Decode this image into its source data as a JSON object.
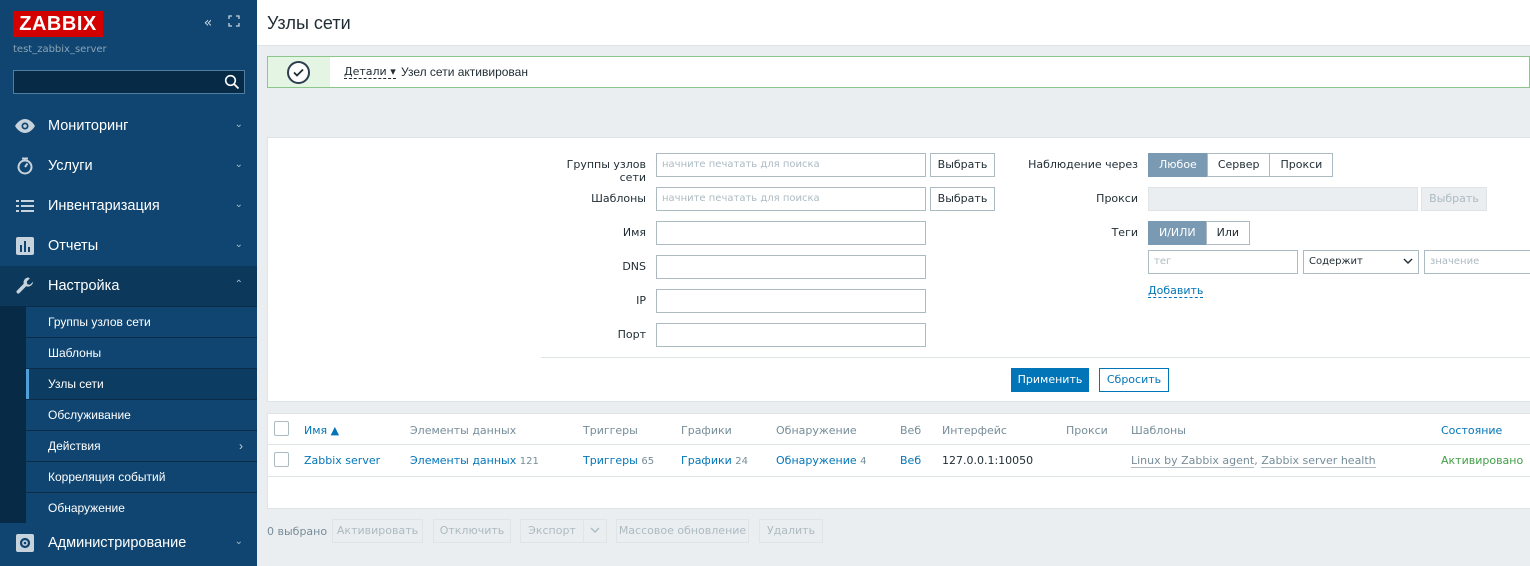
{
  "sidebar": {
    "logo": "ZABBIX",
    "server_name": "test_zabbix_server",
    "search_value": "",
    "collapse_icon": "collapse-icon",
    "expand_icon": "kiosk-icon",
    "menu": [
      {
        "label": "Мониторинг",
        "icon": "eye-icon"
      },
      {
        "label": "Услуги",
        "icon": "timer-icon"
      },
      {
        "label": "Инвентаризация",
        "icon": "list-icon"
      },
      {
        "label": "Отчеты",
        "icon": "chart-icon"
      },
      {
        "label": "Настройка",
        "icon": "wrench-icon"
      }
    ],
    "submenu": [
      {
        "label": "Группы узлов сети"
      },
      {
        "label": "Шаблоны"
      },
      {
        "label": "Узлы сети"
      },
      {
        "label": "Обслуживание"
      },
      {
        "label": "Действия"
      },
      {
        "label": "Корреляция событий"
      },
      {
        "label": "Обнаружение"
      }
    ],
    "admin": {
      "label": "Администрирование",
      "icon": "gear-icon"
    }
  },
  "header": {
    "title": "Узлы сети"
  },
  "message": {
    "details": "Детали",
    "text": "Узел сети активирован"
  },
  "filter": {
    "host_groups_label": "Группы узлов сети",
    "templates_label": "Шаблоны",
    "name_label": "Имя",
    "dns_label": "DNS",
    "ip_label": "IP",
    "port_label": "Порт",
    "search_placeholder": "начните печатать для поиска",
    "select_label": "Выбрать",
    "monitored_by_label": "Наблюдение через",
    "monitored_by_options": [
      "Любое",
      "Сервер",
      "Прокси"
    ],
    "proxy_label": "Прокси",
    "tags_label": "Теги",
    "tags_options": [
      "И/ИЛИ",
      "Или"
    ],
    "tag_placeholder": "тег",
    "tag_operator": "Содержит",
    "value_placeholder": "значение",
    "add_label": "Добавить",
    "apply_label": "Применить",
    "reset_label": "Сбросить"
  },
  "table": {
    "headers": {
      "name": "Имя ▲",
      "items": "Элементы данных",
      "triggers": "Триггеры",
      "graphs": "Графики",
      "discovery": "Обнаружение",
      "web": "Веб",
      "interface": "Интерфейс",
      "proxy": "Прокси",
      "templates": "Шаблоны",
      "status": "Состояние"
    },
    "rows": [
      {
        "name": "Zabbix server",
        "items_label": "Элементы данных",
        "items_count": "121",
        "triggers_label": "Триггеры",
        "triggers_count": "65",
        "graphs_label": "Графики",
        "graphs_count": "24",
        "discovery_label": "Обнаружение",
        "discovery_count": "4",
        "web_label": "Веб",
        "interface": "127.0.0.1:10050",
        "proxy": "",
        "template1": "Linux by Zabbix agent",
        "template_sep": ", ",
        "template2": "Zabbix server health",
        "status": "Активировано"
      }
    ]
  },
  "footer": {
    "selected": "0 выбрано",
    "activate": "Активировать",
    "disable": "Отключить",
    "export": "Экспорт",
    "mass_update": "Массовое обновление",
    "delete": "Удалить"
  },
  "colors": {
    "sidebar_bg": "#0f4570",
    "logo_red": "#d40000",
    "link_blue": "#0275b8",
    "status_green": "#429e47",
    "segment_active": "#7a99b2"
  }
}
